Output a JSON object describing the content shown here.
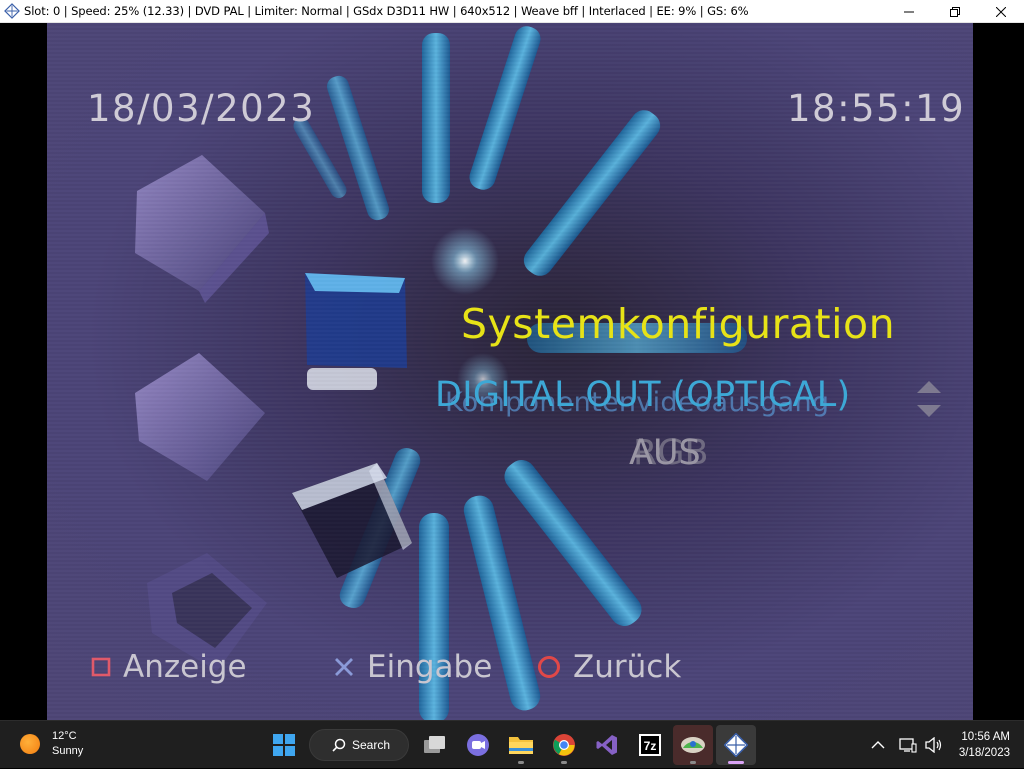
{
  "window": {
    "title": "Slot: 0 | Speed:  25% (12.33) | DVD PAL | Limiter: Normal | GSdx D3D11 HW | 640x512 | Weave bff | Interlaced | EE:   9% | GS:   6%",
    "controls": [
      "minimize-icon",
      "maximize-icon",
      "close-icon"
    ]
  },
  "game": {
    "date": "18/03/2023",
    "time": "18:55:19",
    "menu_title": "Systemkonfiguration",
    "menu_option": "DIGITAL OUT (OPTICAL)",
    "menu_option_ghost": "Komponentenvideoausgang",
    "menu_value": "AUS",
    "menu_value_ghost": "RGB",
    "legend": [
      {
        "icon": "square-button-icon",
        "label": "Anzeige",
        "color": "#e05a6a"
      },
      {
        "icon": "cross-button-icon",
        "label": "Eingabe",
        "color": "#8a9ad8"
      },
      {
        "icon": "circle-button-icon",
        "label": "Zurück",
        "color": "#e04848"
      }
    ],
    "colors": {
      "title": "#e7e317",
      "option": "#3da8d6",
      "value": "#9a96a4",
      "background": "#4c4578"
    }
  },
  "taskbar": {
    "weather": {
      "temp": "12°C",
      "condition": "Sunny"
    },
    "search_label": "Search",
    "apps": [
      "windows-start-icon",
      "search",
      "task-view-icon",
      "teams-chat-icon",
      "file-explorer-icon",
      "chrome-icon",
      "visual-studio-icon",
      "7zip-icon",
      "pcsx2-icon",
      "pcsx2-window-icon"
    ],
    "clock": {
      "time": "10:56 AM",
      "date": "3/18/2023"
    }
  }
}
